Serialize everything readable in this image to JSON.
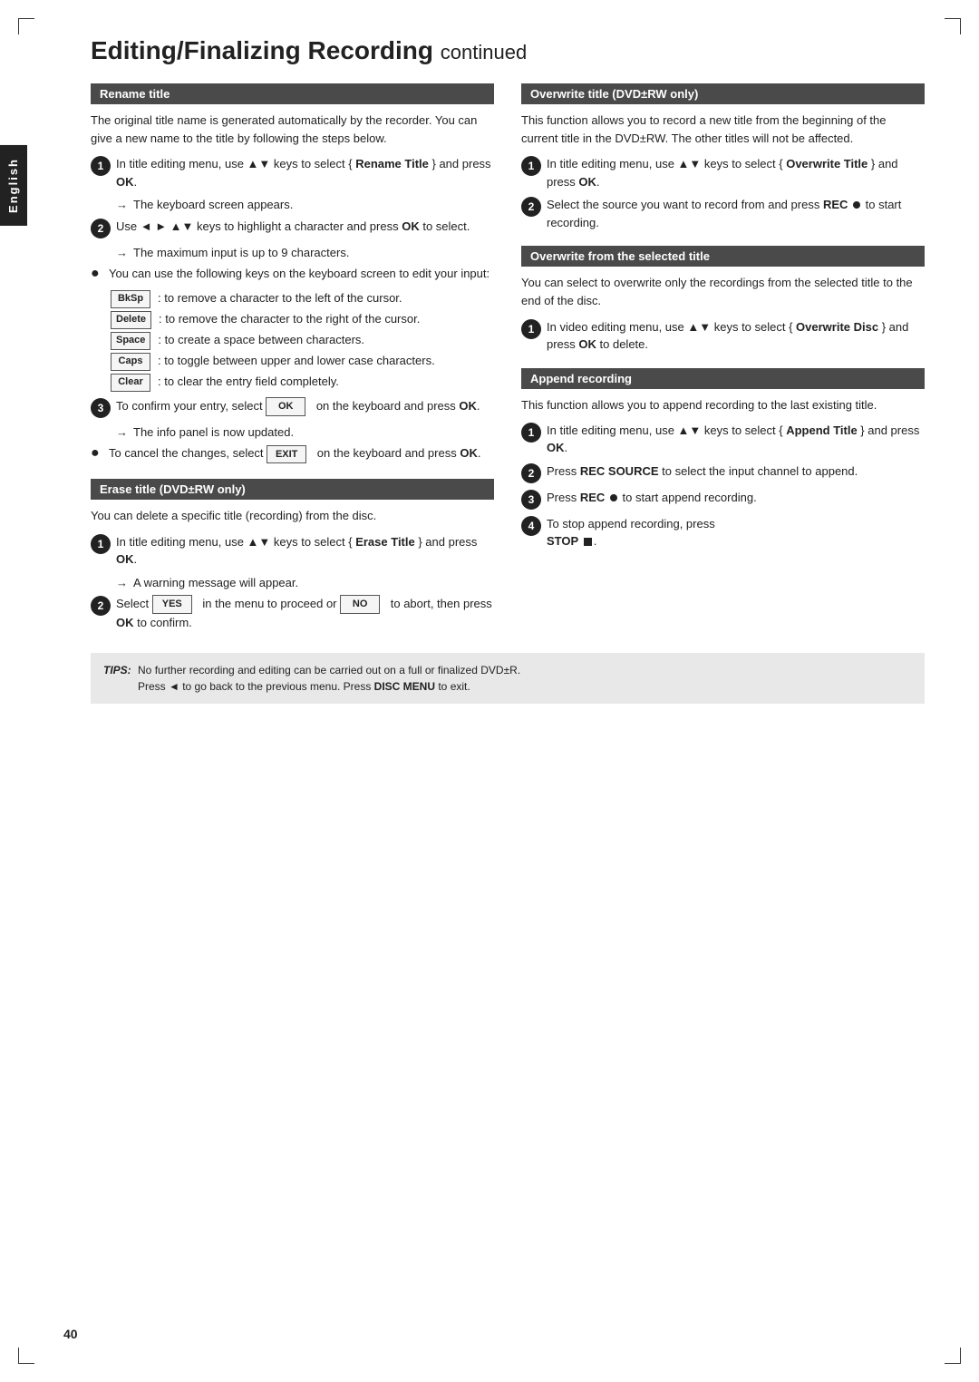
{
  "page": {
    "title": "Editing/Finalizing Recording",
    "title_suffix": "continued",
    "page_number": "40",
    "language_tab": "English"
  },
  "left_column": {
    "rename_title": {
      "header": "Rename title",
      "body": "The original title name is generated automatically by the recorder. You can give a new name to the title by following the steps below.",
      "steps": [
        {
          "num": "1",
          "text": "In title editing menu, use ▲▼ keys to select { Rename Title } and press OK.",
          "arrow": "The keyboard screen appears."
        },
        {
          "num": "2",
          "text": "Use ◄ ► ▲▼ keys to highlight a character and press OK to select.",
          "arrow": "The maximum input is up to 9 characters."
        }
      ],
      "bullet_header": "You can use the following keys on the keyboard screen to edit your input:",
      "keys": [
        {
          "key": "BkSp",
          "desc": ": to remove a character to the left of the cursor."
        },
        {
          "key": "Delete",
          "desc": ": to remove the character to the right of the cursor."
        },
        {
          "key": "Space",
          "desc": ": to create a space between characters."
        },
        {
          "key": "Caps",
          "desc": ": to toggle between upper and lower case characters."
        },
        {
          "key": "Clear",
          "desc": ": to clear the entry field completely."
        }
      ],
      "step3": {
        "num": "3",
        "text": "To confirm your entry, select OK on the keyboard and press OK.",
        "arrow": "The info panel is now updated."
      },
      "step4_bullet": "To cancel the changes, select EXIT on the keyboard and press OK."
    },
    "erase_title": {
      "header": "Erase title (DVD±RW only)",
      "body": "You can delete a specific title (recording) from the disc.",
      "steps": [
        {
          "num": "1",
          "text": "In title editing menu, use ▲▼ keys to select { Erase Title } and press OK.",
          "arrow": "A warning message will appear."
        },
        {
          "num": "2",
          "text": "Select YES in the menu to proceed or NO to abort, then press OK to confirm."
        }
      ]
    }
  },
  "right_column": {
    "overwrite_title": {
      "header": "Overwrite title (DVD±RW only)",
      "body": "This function allows you to record a new title from the beginning of the current title in the DVD±RW. The other titles will not be affected.",
      "steps": [
        {
          "num": "1",
          "text": "In title editing menu, use ▲▼ keys to select { Overwrite Title } and press OK."
        },
        {
          "num": "2",
          "text": "Select the source you want to record from and press REC ● to start recording."
        }
      ]
    },
    "overwrite_selected": {
      "header": "Overwrite from the selected title",
      "body": "You can select to overwrite only the recordings from the selected title to the end of the disc.",
      "steps": [
        {
          "num": "1",
          "text": "In video editing menu, use ▲▼ keys to select { Overwrite Disc } and press OK to delete."
        }
      ]
    },
    "append_recording": {
      "header": "Append recording",
      "body": "This function allows you to append recording to the last existing title.",
      "steps": [
        {
          "num": "1",
          "text": "In title editing menu, use ▲▼ keys to select { Append Title } and press OK."
        },
        {
          "num": "2",
          "text": "Press REC SOURCE to select the input channel to append."
        },
        {
          "num": "3",
          "text": "Press REC ● to start append recording."
        },
        {
          "num": "4",
          "text": "To stop append recording, press STOP ■."
        }
      ]
    }
  },
  "tips": {
    "label": "TIPS:",
    "lines": [
      "No further recording and editing can be carried out on a full or finalized DVD±R.",
      "Press ◄ to go back to the previous menu. Press DISC MENU to exit."
    ]
  }
}
